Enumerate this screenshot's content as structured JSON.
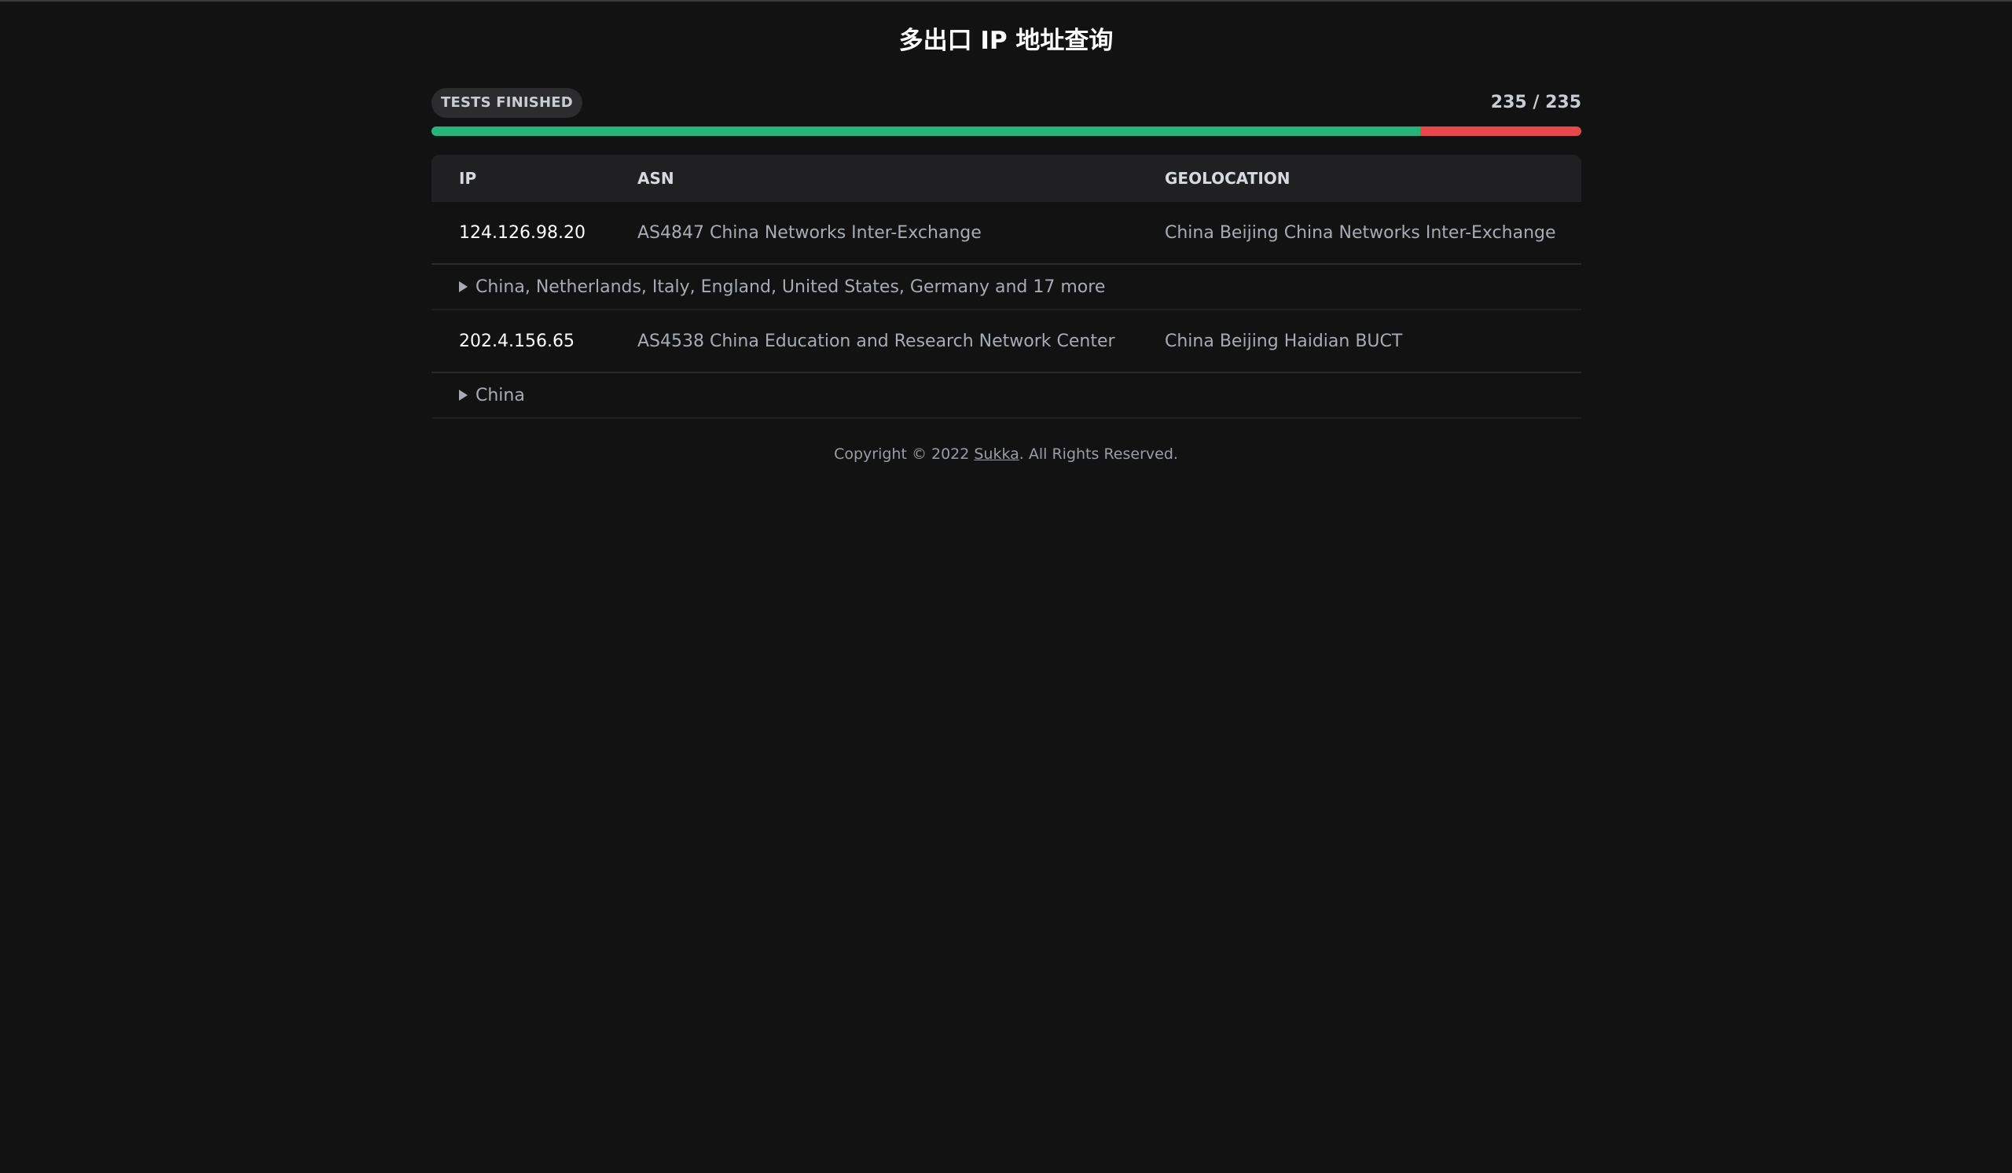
{
  "title": "多出口 IP 地址查询",
  "status": {
    "badge": "TESTS FINISHED",
    "count": "235 / 235",
    "success_fraction": 0.86,
    "success_color": "#27b37a",
    "fail_color": "#e5484d"
  },
  "table": {
    "headers": {
      "ip": "IP",
      "asn": "ASN",
      "geo": "GEOLOCATION"
    },
    "rows": [
      {
        "ip": "124.126.98.20",
        "asn": "AS4847 China Networks Inter-Exchange",
        "geo": "China Beijing China Networks Inter-Exchange",
        "countries": "China, Netherlands, Italy, England, United States, Germany and 17 more"
      },
      {
        "ip": "202.4.156.65",
        "asn": "AS4538 China Education and Research Network Center",
        "geo": "China Beijing Haidian BUCT",
        "countries": "China"
      }
    ]
  },
  "footer": {
    "prefix": "Copyright © 2022 ",
    "link": "Sukka",
    "suffix": ". All Rights Reserved."
  },
  "icons": {
    "expand": "triangle-right-icon"
  }
}
